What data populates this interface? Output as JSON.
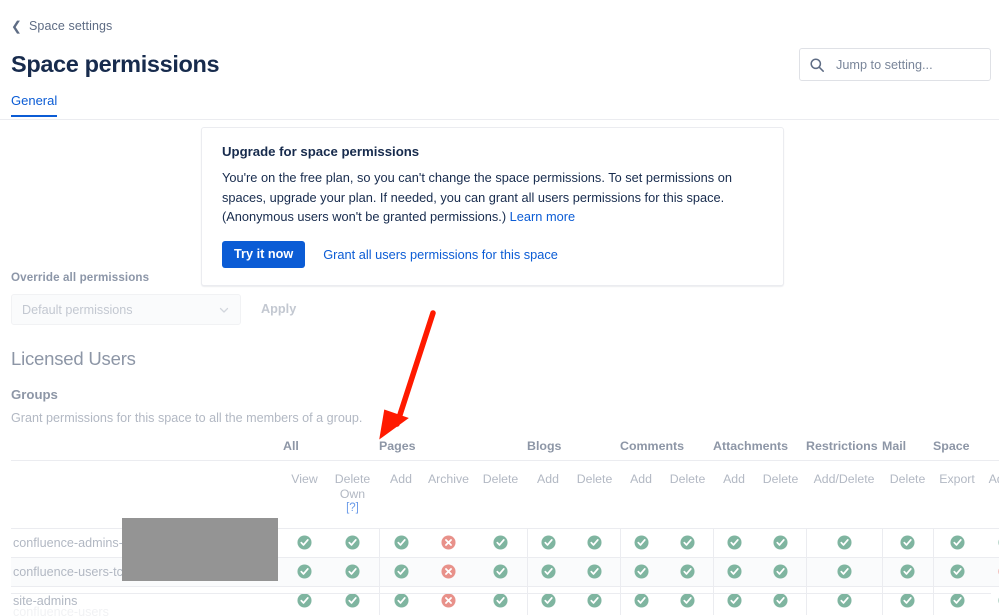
{
  "breadcrumb": {
    "back_icon": "chevron-left-icon",
    "label": "Space settings"
  },
  "header": {
    "title": "Space permissions"
  },
  "search": {
    "icon": "search-icon",
    "placeholder": "Jump to setting...",
    "value": ""
  },
  "tabs": [
    {
      "label": "General",
      "selected": true
    }
  ],
  "banner": {
    "title": "Upgrade for space permissions",
    "body": "You're on the free plan, so you can't change the space permissions. To set permissions on spaces, upgrade your plan. If needed, you can grant all users permissions for this space. (Anonymous users won't be granted permissions.)",
    "learn_more": "Learn more",
    "primary_button": "Try it now",
    "secondary_button": "Grant all users permissions for this space",
    "accent_color": "#0B5CD5"
  },
  "override": {
    "label": "Override all permissions",
    "select_value": "Default permissions",
    "select_icon": "chevron-down-icon",
    "apply_button": "Apply",
    "disabled": true
  },
  "licensed_users": {
    "section_title": "Licensed Users",
    "groups_title": "Groups",
    "groups_subtitle": "Grant permissions for this space to all the members of a group."
  },
  "permissions_table": {
    "group_headers": [
      {
        "label": "",
        "span": 1
      },
      {
        "label": "All",
        "span": 2
      },
      {
        "label": "Pages",
        "span": 3
      },
      {
        "label": "Blogs",
        "span": 2
      },
      {
        "label": "Comments",
        "span": 2
      },
      {
        "label": "Attachments",
        "span": 2
      },
      {
        "label": "Restrictions",
        "span": 1
      },
      {
        "label": "Mail",
        "span": 1
      },
      {
        "label": "Space",
        "span": 2
      }
    ],
    "sub_headers": [
      "",
      "View",
      "Delete Own",
      "Add",
      "Archive",
      "Delete",
      "Add",
      "Delete",
      "Add",
      "Delete",
      "Add",
      "Delete",
      "Add/Delete",
      "Delete",
      "Export",
      "Admin"
    ],
    "delete_own_help": "[?]",
    "rows": [
      {
        "name": "confluence-admins-",
        "redacted": true,
        "values": [
          "yes",
          "yes",
          "yes",
          "no",
          "yes",
          "yes",
          "yes",
          "yes",
          "yes",
          "yes",
          "yes",
          "yes",
          "yes",
          "yes",
          "yes"
        ]
      },
      {
        "name": "confluence-users-tc",
        "redacted": true,
        "values": [
          "yes",
          "yes",
          "yes",
          "no",
          "yes",
          "yes",
          "yes",
          "yes",
          "yes",
          "yes",
          "yes",
          "yes",
          "yes",
          "yes",
          "no"
        ]
      },
      {
        "name": "site-admins",
        "redacted": false,
        "values": [
          "yes",
          "yes",
          "yes",
          "no",
          "yes",
          "yes",
          "yes",
          "yes",
          "yes",
          "yes",
          "yes",
          "yes",
          "yes",
          "yes",
          "yes"
        ]
      }
    ],
    "icons": {
      "yes": "check-circle-icon",
      "no": "cross-circle-icon"
    },
    "colors": {
      "yes": "#7FB5A0",
      "no": "#E8918A"
    }
  },
  "annotation": {
    "type": "arrow",
    "color": "#FF1A00",
    "points_to": "Pages"
  }
}
